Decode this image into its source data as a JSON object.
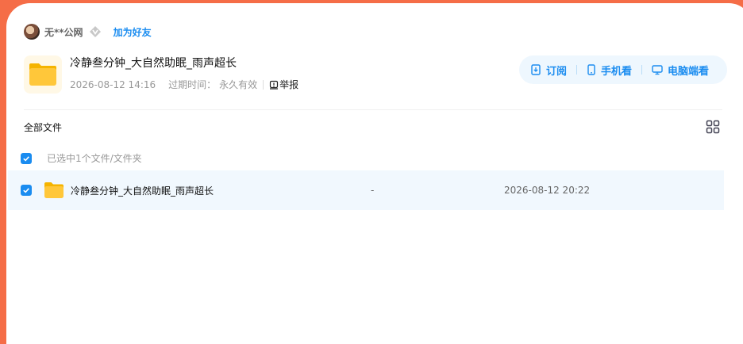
{
  "user": {
    "name": "无**公网",
    "add_friend": "加为好友"
  },
  "share": {
    "title": "冷静叁分钟_大自然助眠_雨声超长",
    "created": "2026-08-12 14:16",
    "expire_label": "过期时间：",
    "expire_value": "永久有效",
    "report": "举报"
  },
  "actions": {
    "subscribe": "订阅",
    "phone": "手机看",
    "pc": "电脑端看"
  },
  "breadcrumb": "全部文件",
  "selection": {
    "text": "已选中1个文件/文件夹"
  },
  "files": [
    {
      "name": "冷静叁分钟_大自然助眠_雨声超长",
      "size": "-",
      "date": "2026-08-12 20:22"
    }
  ],
  "colors": {
    "accent": "#1a8cf0",
    "background": "#f56d47",
    "folder": "#ffc73a"
  }
}
